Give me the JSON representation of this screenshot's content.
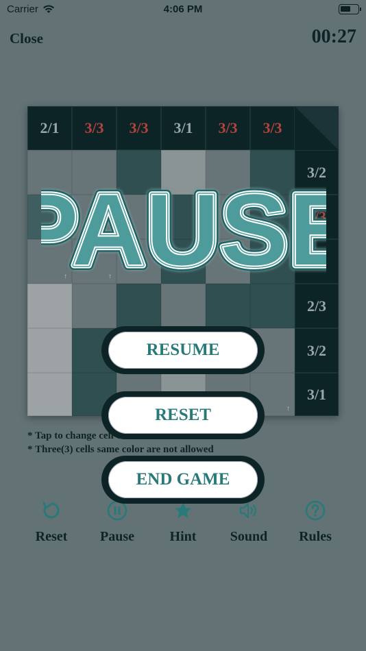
{
  "status": {
    "carrier": "Carrier",
    "time": "4:06 PM"
  },
  "header": {
    "close_label": "Close",
    "timer": "00:27"
  },
  "board": {
    "column_headers": [
      {
        "text": "2/1",
        "status": "ok"
      },
      {
        "text": "3/3",
        "status": "bad"
      },
      {
        "text": "3/3",
        "status": "bad"
      },
      {
        "text": "3/1",
        "status": "ok"
      },
      {
        "text": "3/3",
        "status": "bad"
      },
      {
        "text": "3/3",
        "status": "bad"
      }
    ],
    "row_headers": [
      {
        "text": "3/2",
        "status": "ok"
      },
      {
        "text": "3/3",
        "status": "bad"
      },
      {
        "text": "3/3",
        "status": "bad"
      },
      {
        "text": "2/3",
        "status": "ok"
      },
      {
        "text": "3/2",
        "status": "ok"
      },
      {
        "text": "3/1",
        "status": "ok"
      }
    ]
  },
  "pause": {
    "title": "PAUSE"
  },
  "instructions": {
    "line1": "* Tap to change cell color",
    "line2": "* Three(3) cells same color are not allowed"
  },
  "menu": {
    "resume_label": "RESUME",
    "reset_label": "RESET",
    "end_label": "END GAME"
  },
  "toolbar": {
    "reset_label": "Reset",
    "pause_label": "Pause",
    "hint_label": "Hint",
    "sound_label": "Sound",
    "rules_label": "Rules"
  },
  "colors": {
    "accent": "#287a79",
    "dark": "#0d2426",
    "overlay": "#627275"
  }
}
